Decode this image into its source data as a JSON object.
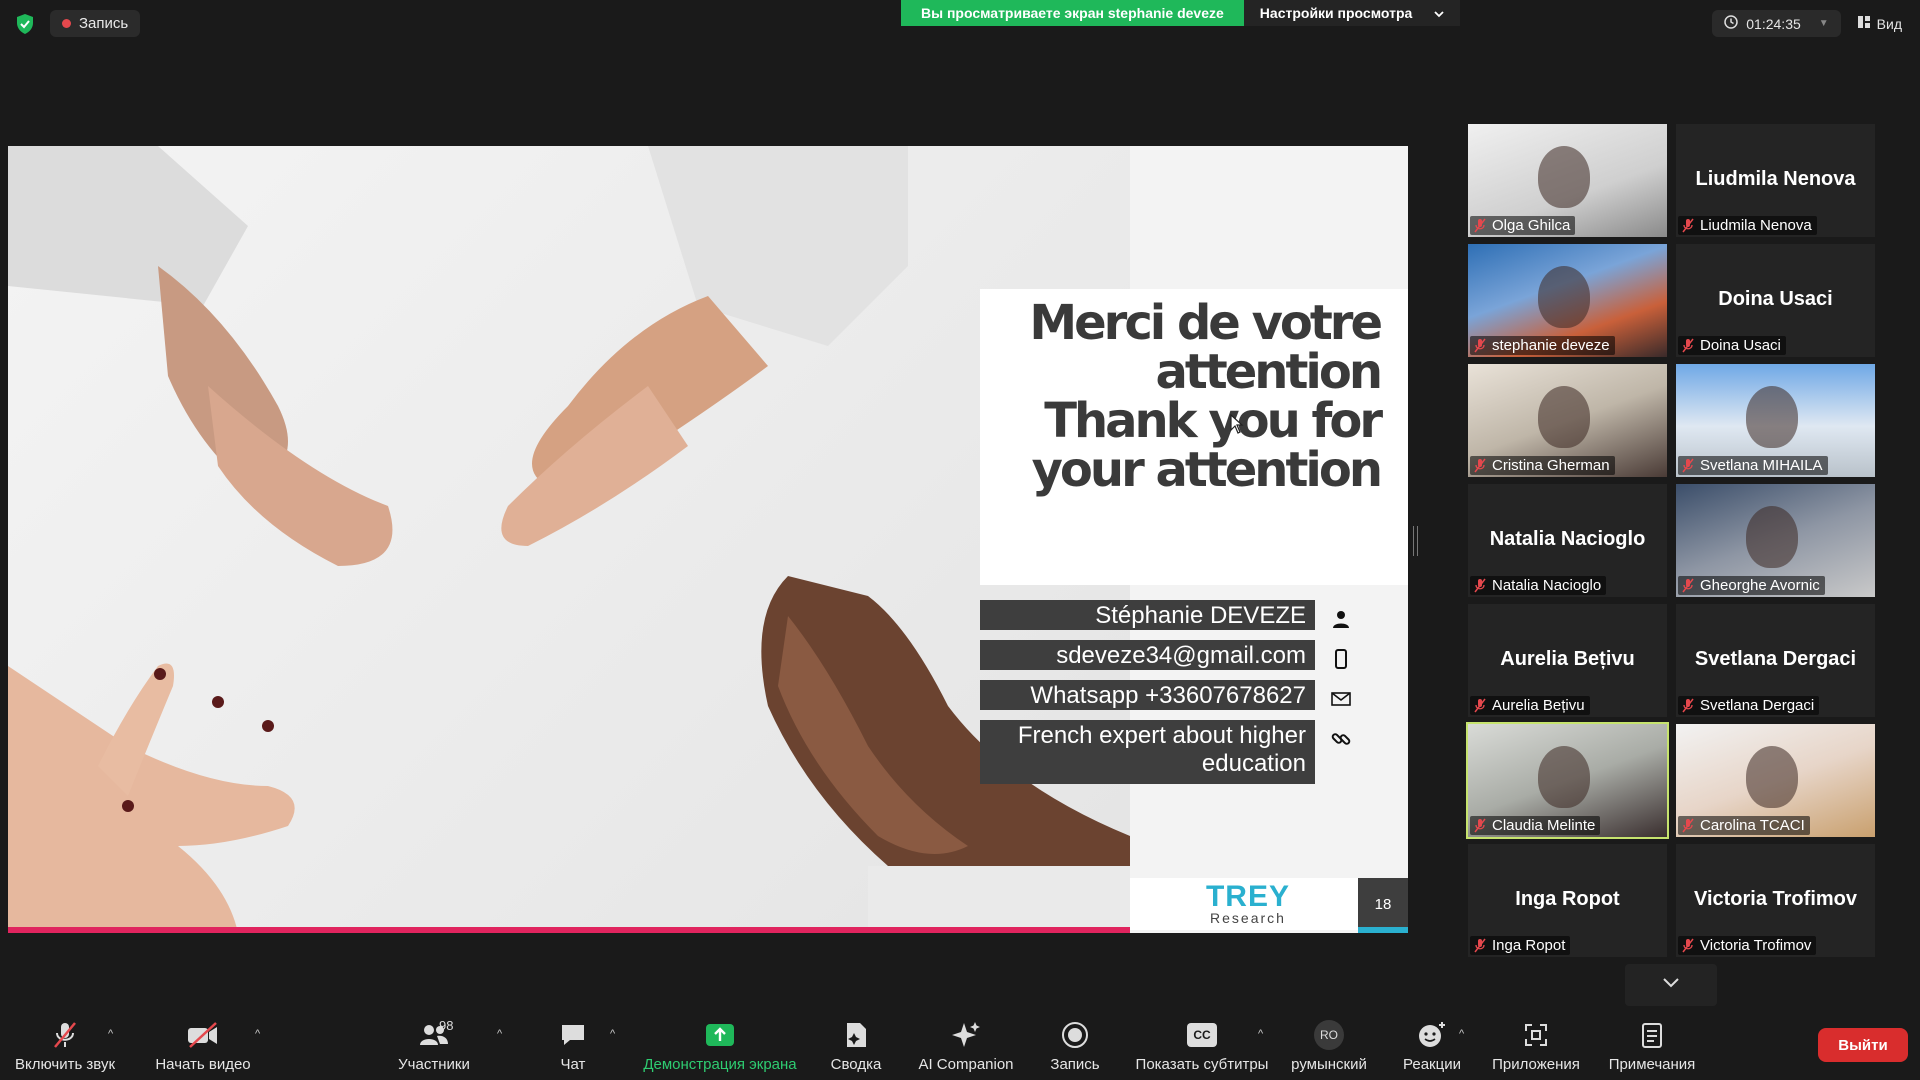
{
  "topbar": {
    "recording_label": "Запись",
    "share_banner": "Вы просматриваете экран stephanie deveze",
    "view_settings": "Настройки просмотра",
    "timer": "01:24:35",
    "view_label": "Вид"
  },
  "slide": {
    "title": "Merci de votre\nattention\nThank you for\nyour attention",
    "info": [
      {
        "text": "Stéphanie DEVEZE",
        "icon": "person-icon"
      },
      {
        "text": "sdeveze34@gmail.com",
        "icon": "phone-icon"
      },
      {
        "text": "Whatsapp +33607678627",
        "icon": "mail-icon"
      },
      {
        "text": "French expert about higher education",
        "icon": "link-icon"
      }
    ],
    "logo_main": "TREY",
    "logo_sub": "Research",
    "page_number": "18"
  },
  "participants": [
    {
      "name": "Olga Ghilca",
      "video": true
    },
    {
      "name": "Liudmila Nenova",
      "video": false
    },
    {
      "name": "stephanie deveze",
      "video": true
    },
    {
      "name": "Doina Usaci",
      "video": false
    },
    {
      "name": "Cristina Gherman",
      "video": true
    },
    {
      "name": "Svetlana MIHAILA",
      "video": true
    },
    {
      "name": "Natalia Nacioglo",
      "video": false
    },
    {
      "name": "Gheorghe Avornic",
      "video": true
    },
    {
      "name": "Aurelia Bețivu",
      "video": false
    },
    {
      "name": "Svetlana Dergaci",
      "video": false
    },
    {
      "name": "Claudia Melinte",
      "video": true
    },
    {
      "name": "Carolina TCACI",
      "video": true
    },
    {
      "name": "Inga Ropot",
      "video": false
    },
    {
      "name": "Victoria Trofimov",
      "video": false
    }
  ],
  "toolbar": {
    "audio": "Включить звук",
    "video": "Начать видео",
    "participants": "Участники",
    "participants_count": "98",
    "chat": "Чат",
    "share": "Демонстрация экрана",
    "summary": "Сводка",
    "ai": "AI Companion",
    "record": "Запись",
    "captions": "Показать субтитры",
    "cc": "CC",
    "language": "румынский",
    "language_badge": "RO",
    "reactions": "Реакции",
    "apps": "Приложения",
    "notes": "Примечания",
    "leave": "Выйти"
  },
  "colors": {
    "share_green": "#1fb85a",
    "leave_red": "#d92d2d",
    "accent_pink": "#e0245e",
    "trey_blue": "#2ab0cf",
    "active_speaker": "#c6e36e"
  }
}
